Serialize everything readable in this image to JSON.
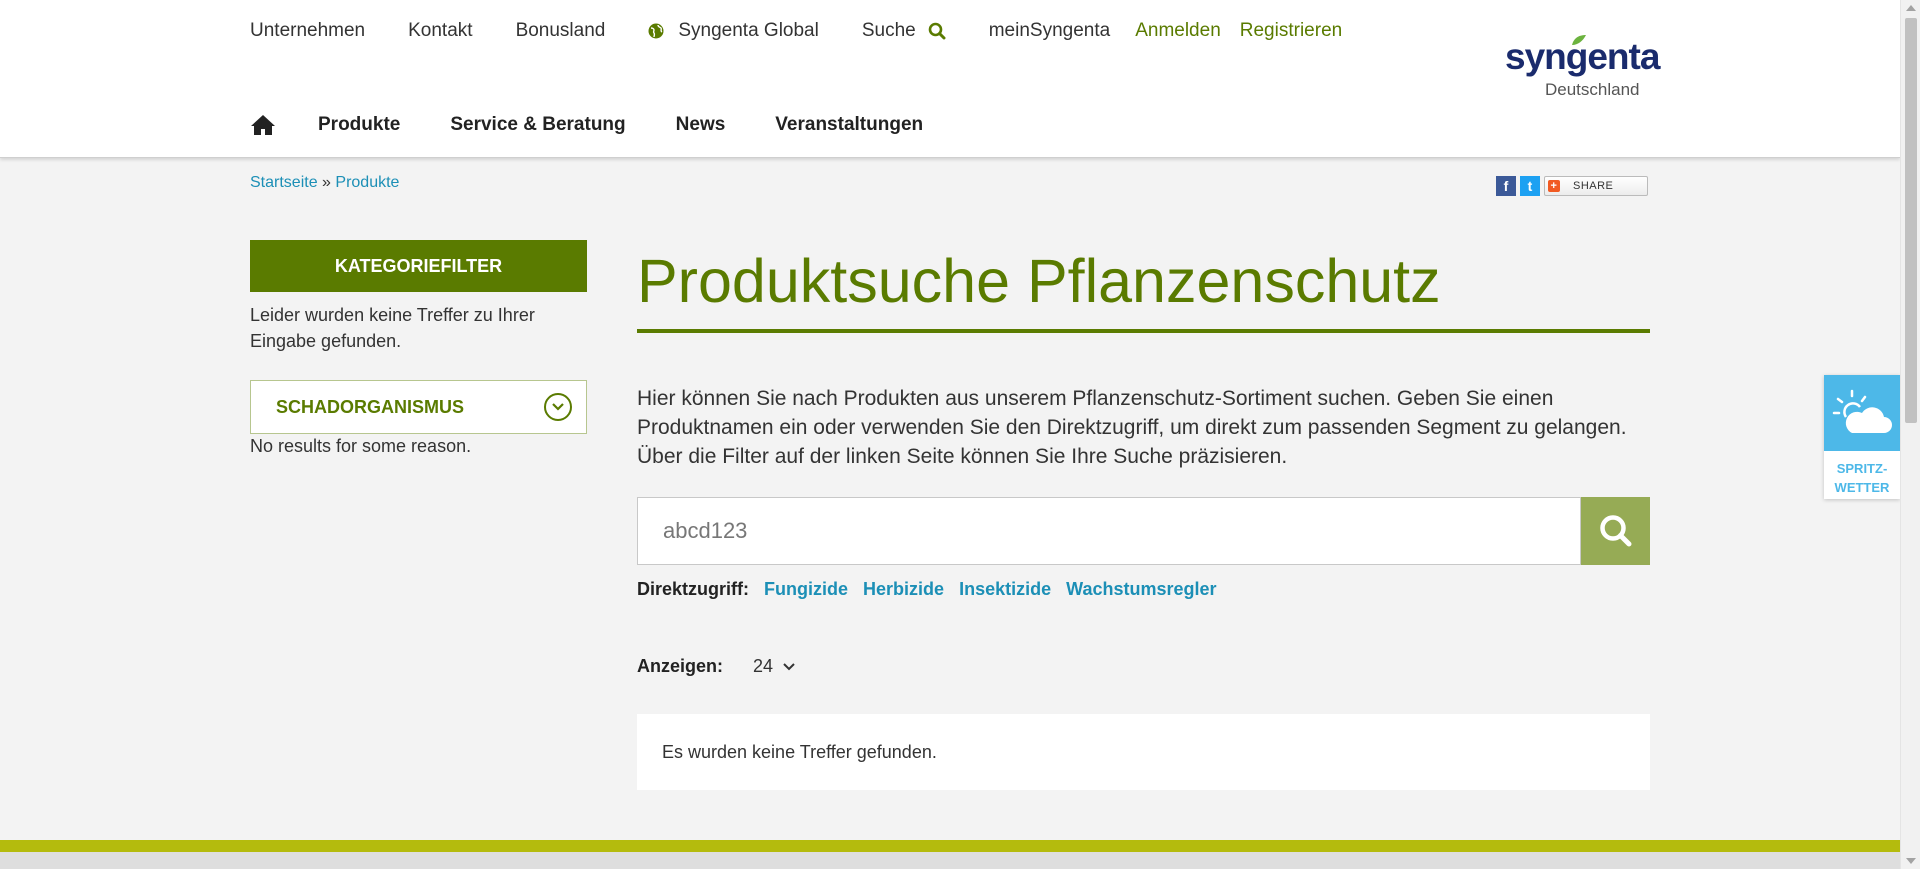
{
  "topnav": {
    "unternehmen": "Unternehmen",
    "kontakt": "Kontakt",
    "bonusland": "Bonusland",
    "global": "Syngenta Global",
    "suche": "Suche",
    "meinsyngenta": "meinSyngenta",
    "anmelden": "Anmelden",
    "registrieren": "Registrieren"
  },
  "logo": {
    "word": "syngenta",
    "sub": "Deutschland"
  },
  "mainnav": {
    "home_icon": "home-icon",
    "produkte": "Produkte",
    "service": "Service & Beratung",
    "news": "News",
    "veranstaltungen": "Veranstaltungen"
  },
  "breadcrumb": {
    "home": "Startseite",
    "sep": "»",
    "current": "Produkte"
  },
  "share": {
    "label": "SHARE",
    "facebook": "f",
    "twitter": "t"
  },
  "sidebar": {
    "kategoriefilter": "KATEGORIEFILTER",
    "no_results": "Leider wurden keine Treffer zu Ihrer Eingabe gefunden.",
    "filter_label": "SCHADORGANISMUS",
    "filter_no_results": "No results for some reason."
  },
  "main": {
    "title": "Produktsuche Pflanzenschutz",
    "intro": "Hier können Sie nach Produkten aus unserem Pflanzenschutz-Sortiment suchen. Geben Sie einen Produktnamen ein oder verwenden Sie den Direktzugriff, um direkt zum passenden Segment zu gelangen. Über die Filter auf der linken Seite können Sie Ihre Suche präzisieren.",
    "search_value": "abcd123",
    "direkt_label": "Direktzugriff:",
    "direkt_links": [
      "Fungizide",
      "Herbizide",
      "Insektizide",
      "Wachstumsregler"
    ],
    "anzeigen_label": "Anzeigen:",
    "anzeigen_value": "24",
    "result_text": "Es wurden keine Treffer gefunden."
  },
  "weather": {
    "line1": "SPRITZ-",
    "line2": "WETTER"
  },
  "colors": {
    "brand_green": "#5a7b00",
    "link_blue": "#1c8fb6",
    "search_btn": "#96ab55",
    "footer_bar": "#b4bb0d",
    "weather_blue": "#4db8e8"
  }
}
